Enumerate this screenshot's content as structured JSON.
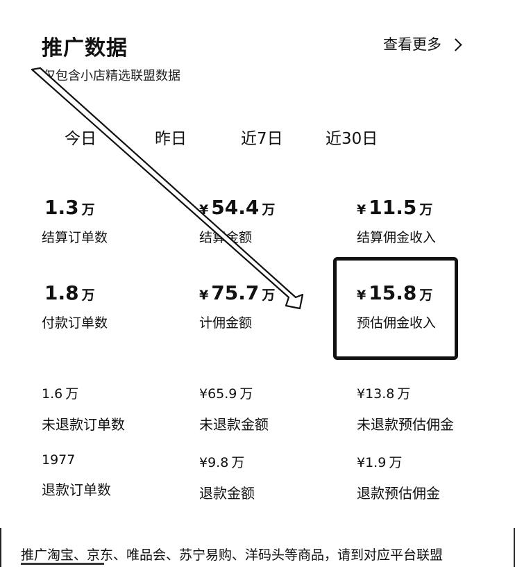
{
  "header": {
    "title": "推广数据",
    "more_label": "查看更多"
  },
  "subtitle": "仅包含小店精选联盟数据",
  "tabs": [
    "今日",
    "昨日",
    "近7日",
    "近30日"
  ],
  "stats": [
    {
      "currency": "",
      "number": "1.3",
      "unit": "万",
      "label": "结算订单数"
    },
    {
      "currency": "¥",
      "number": "54.4",
      "unit": "万",
      "label": "结算金额"
    },
    {
      "currency": "¥",
      "number": "11.5",
      "unit": "万",
      "label": "结算佣金收入"
    },
    {
      "currency": "",
      "number": "1.8",
      "unit": "万",
      "label": "付款订单数"
    },
    {
      "currency": "¥",
      "number": "75.7",
      "unit": "万",
      "label": "计佣金额"
    },
    {
      "currency": "¥",
      "number": "15.8",
      "unit": "万",
      "label": "预估佣金收入"
    },
    {
      "currency": "",
      "number": "1.6",
      "unit": "万",
      "label": "未退款订单数"
    },
    {
      "currency": "¥",
      "number": "65.9",
      "unit": "万",
      "label": "未退款金额"
    },
    {
      "currency": "¥",
      "number": "13.8",
      "unit": "万",
      "label": "未退款预估佣金"
    },
    {
      "currency": "",
      "number": "1977",
      "unit": "",
      "label": "退款订单数"
    },
    {
      "currency": "¥",
      "number": "9.8",
      "unit": "万",
      "label": "退款金额"
    },
    {
      "currency": "¥",
      "number": "1.9",
      "unit": "万",
      "label": "退款预估佣金"
    }
  ],
  "footer": {
    "text": "推广淘宝、京东、唯品会、苏宁易购、洋码头等商品，请到对应平台联盟"
  },
  "icons": {
    "more": "chevron-right-icon",
    "annotation": "arrow-annotation-icon"
  },
  "colors": {
    "text": "#111111",
    "background": "#ffffff"
  }
}
